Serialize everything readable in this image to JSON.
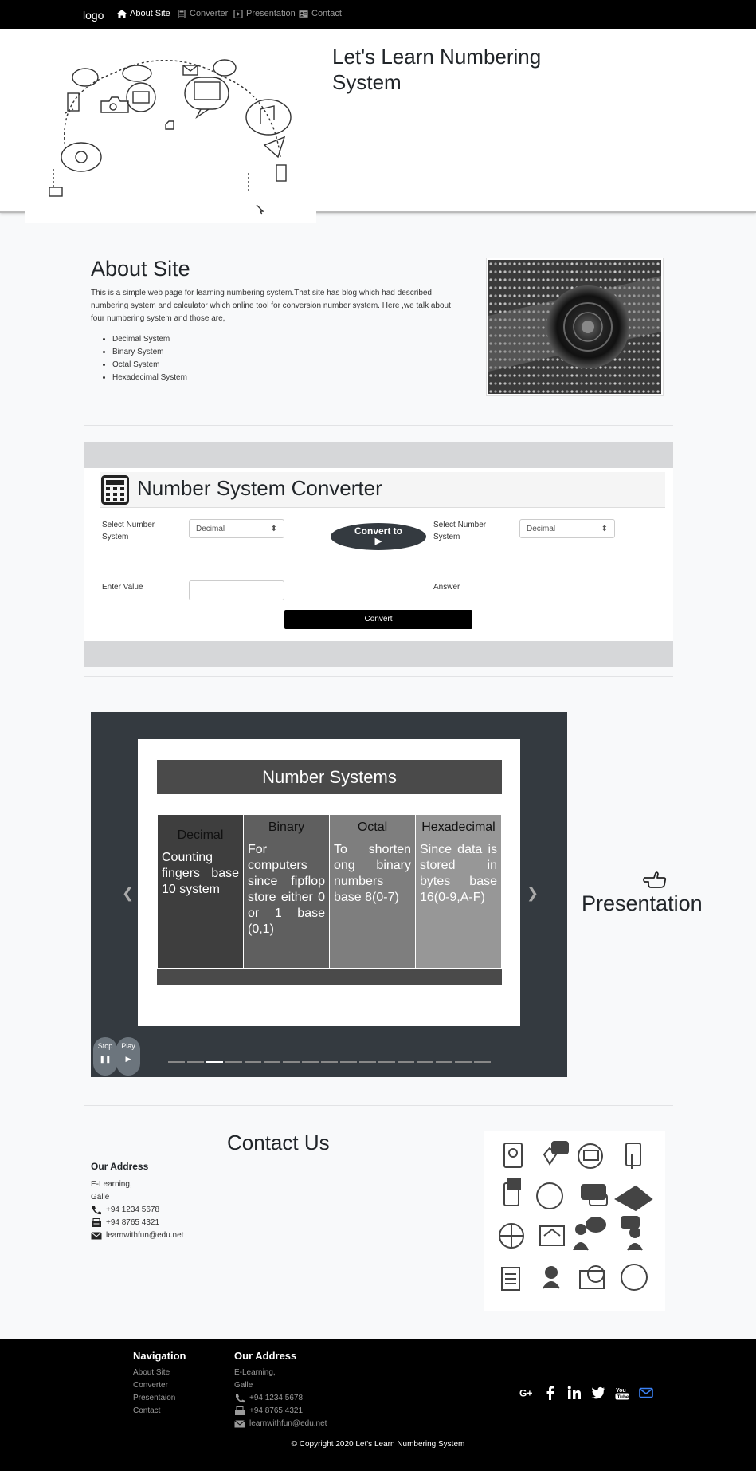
{
  "navbar": {
    "logo": "logo",
    "items": [
      {
        "label": "About Site",
        "icon": "home-icon",
        "active": true
      },
      {
        "label": "Converter",
        "icon": "calculator-icon",
        "active": false
      },
      {
        "label": "Presentation",
        "icon": "play-square-icon",
        "active": false
      },
      {
        "label": "Contact",
        "icon": "id-card-icon",
        "active": false
      }
    ]
  },
  "hero": {
    "title": "Let's Learn Numbering System",
    "image_icon": "social-media-doodle-illustration"
  },
  "about": {
    "title": "About Site",
    "text": "This is a simple web page for learning numbering system.That site has blog which had described numbering system and calculator which online tool for conversion number system. Here ,we talk about four numbering system and those are,",
    "list": [
      "Decimal System",
      "Binary System",
      "Octal System",
      "Hexadecimal System"
    ],
    "image_icon": "binary-data-eye-image"
  },
  "converter": {
    "title": "Number System Converter",
    "select_label_1": "Select Number System",
    "select_value_1": "Decimal",
    "convert_to_label": "Convert to",
    "select_label_2": "Select Number System",
    "select_value_2": "Decimal",
    "enter_value_label": "Enter Value",
    "answer_label": "Answer",
    "convert_button": "Convert"
  },
  "presentation": {
    "label": "Presentation",
    "slide_title": "Number Systems",
    "columns": [
      {
        "heading": "Decimal",
        "text": "Counting fingers base 10 system",
        "bg": "#3e3e3e"
      },
      {
        "heading": "Binary",
        "text": "For computers since fipflop store either 0 or 1 base (0,1)",
        "bg": "#5f5f5f"
      },
      {
        "heading": "Octal",
        "text": "To shorten ong binary numbers base 8(0-7)",
        "bg": "#7e7e7e"
      },
      {
        "heading": "Hexadecimal",
        "text": "Since data is stored in bytes base 16(0-9,A-F)",
        "bg": "#979797"
      }
    ],
    "stop_label": "Stop",
    "play_label": "Play",
    "indicator_count": 17,
    "active_indicator": 2
  },
  "contact": {
    "title": "Contact Us",
    "address_title": "Our Address",
    "address_line1": "E-Learning,",
    "address_line2": "Galle",
    "phone": "+94 1234 5678",
    "fax": "+94 8765 4321",
    "email": "learnwithfun@edu.net",
    "image_icon": "contact-icons-grid"
  },
  "footer": {
    "nav_title": "Navigation",
    "nav_links": [
      "About Site",
      "Converter",
      "Presentaion",
      "Contact"
    ],
    "address_title": "Our Address",
    "address_line1": "E-Learning,",
    "address_line2": "Galle",
    "phone": "+94 1234 5678",
    "fax": "+94 8765 4321",
    "email": "learnwithfun@edu.net",
    "social_icons": [
      "google-plus-icon",
      "facebook-icon",
      "linkedin-icon",
      "twitter-icon",
      "youtube-icon",
      "email-icon"
    ],
    "copyright": "© Copyright 2020 Let's Learn Numbering System"
  }
}
